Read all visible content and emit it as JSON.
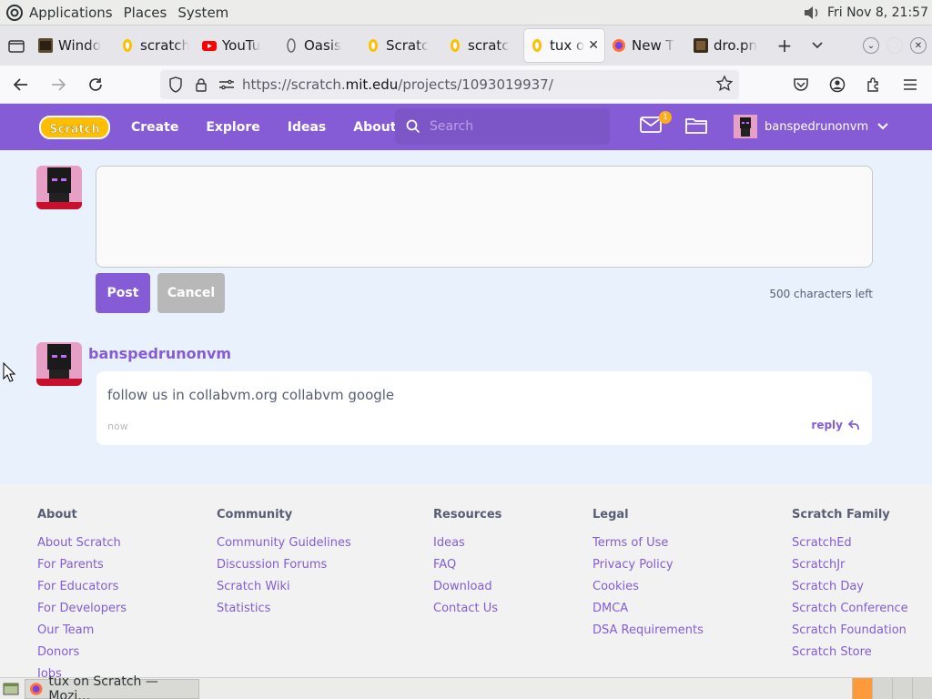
{
  "system_panel": {
    "menus": [
      "Applications",
      "Places",
      "System"
    ],
    "clock": "Fri Nov  8, 21:57"
  },
  "browser": {
    "tabs": [
      {
        "label": "Windo",
        "icon": "film-icon"
      },
      {
        "label": "scratch",
        "icon": "scratch-icon"
      },
      {
        "label": "YouTu",
        "icon": "youtube-icon"
      },
      {
        "label": "Oasis",
        "icon": "oasis-icon"
      },
      {
        "label": "Scratc",
        "icon": "scratch-icon"
      },
      {
        "label": "scratc",
        "icon": "scratch-icon"
      },
      {
        "label": "tux o",
        "icon": "scratch-icon",
        "active": true
      },
      {
        "label": "New T",
        "icon": "firefox-icon"
      },
      {
        "label": "dro.pn",
        "icon": "image-icon"
      }
    ],
    "url": {
      "prefix": "https://scratch.",
      "domain": "mit.edu",
      "suffix": "/projects/1093019937/"
    }
  },
  "scratch_header": {
    "logo": "Scratch",
    "nav": [
      "Create",
      "Explore",
      "Ideas",
      "About"
    ],
    "search_placeholder": "Search",
    "message_count": "1",
    "username": "banspedrunonvm"
  },
  "comment_form": {
    "value": "",
    "post_label": "Post",
    "cancel_label": "Cancel",
    "chars_left": "500 characters left"
  },
  "comment": {
    "username": "banspedrunonvm",
    "text": "follow us in collabvm.org collabvm google",
    "time": "now",
    "reply_label": "reply"
  },
  "footer": {
    "columns": [
      {
        "title": "About",
        "links": [
          "About Scratch",
          "For Parents",
          "For Educators",
          "For Developers",
          "Our Team",
          "Donors",
          "Jobs"
        ]
      },
      {
        "title": "Community",
        "links": [
          "Community Guidelines",
          "Discussion Forums",
          "Scratch Wiki",
          "Statistics"
        ]
      },
      {
        "title": "Resources",
        "links": [
          "Ideas",
          "FAQ",
          "Download",
          "Contact Us"
        ]
      },
      {
        "title": "Legal",
        "links": [
          "Terms of Use",
          "Privacy Policy",
          "Cookies",
          "DMCA",
          "DSA Requirements"
        ]
      },
      {
        "title": "Scratch Family",
        "links": [
          "ScratchEd",
          "ScratchJr",
          "Scratch Day",
          "Scratch Conference",
          "Scratch Foundation",
          "Scratch Store"
        ]
      }
    ]
  },
  "taskbar": {
    "window_label": "tux on Scratch — Mozi…"
  },
  "colors": {
    "scratch_purple": "#855cd6",
    "page_bg": "#e9f1fc",
    "badge": "#ffab1a"
  }
}
